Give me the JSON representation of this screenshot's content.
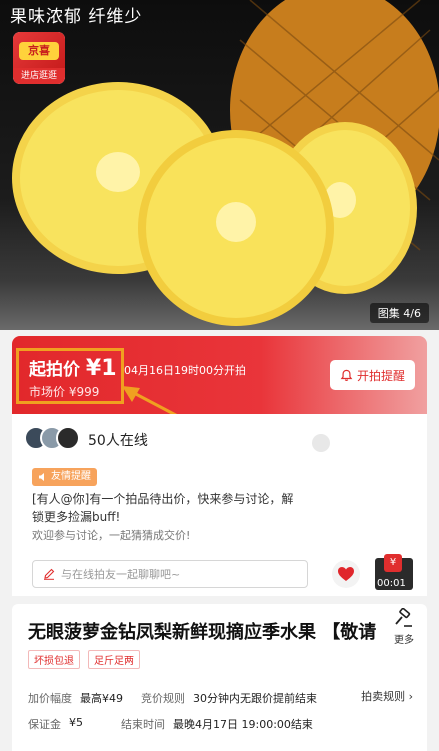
{
  "hero": {
    "title": "果味浓郁 纤维少",
    "shop_logo_text": "京喜",
    "shop_enter_label": "进店逛逛",
    "gallery_count": "图集 4/6"
  },
  "auction": {
    "start_price_label": "起拍价",
    "start_price_value": "¥1",
    "market_price": "市场价 ¥999",
    "start_time": "04月16日19时00分开拍",
    "remind_label": "开拍提醒"
  },
  "chat": {
    "online_count": "50人在线",
    "hint_tag": "友情提醒",
    "message": "[有人@你]有一个拍品待出价，快来参与讨论，解锁更多捡漏buff!",
    "welcome": "欢迎参与讨论，一起猜猜成交价!",
    "input_placeholder": "与在线拍友一起聊聊吧~",
    "live_time": "00:01",
    "live_badge": "¥"
  },
  "product": {
    "title": "无眼菠萝金钻凤梨新鲜现摘应季水果 【敬请",
    "more_label": "更多",
    "tags": [
      "坏损包退",
      "足斤足两"
    ],
    "rules": {
      "increment_label": "加价幅度",
      "increment_value": "最高¥49",
      "rule_label": "竞价规则",
      "rule_value": "30分钟内无跟价提前结束",
      "deposit_label": "保证金",
      "deposit_value": "¥5",
      "end_label": "结束时间",
      "end_value": "最晚4月17日 19:00:00结束",
      "link_label": "拍卖规则"
    }
  },
  "colors": {
    "accent": "#e02e2e",
    "highlight_border": "#f0a020"
  }
}
